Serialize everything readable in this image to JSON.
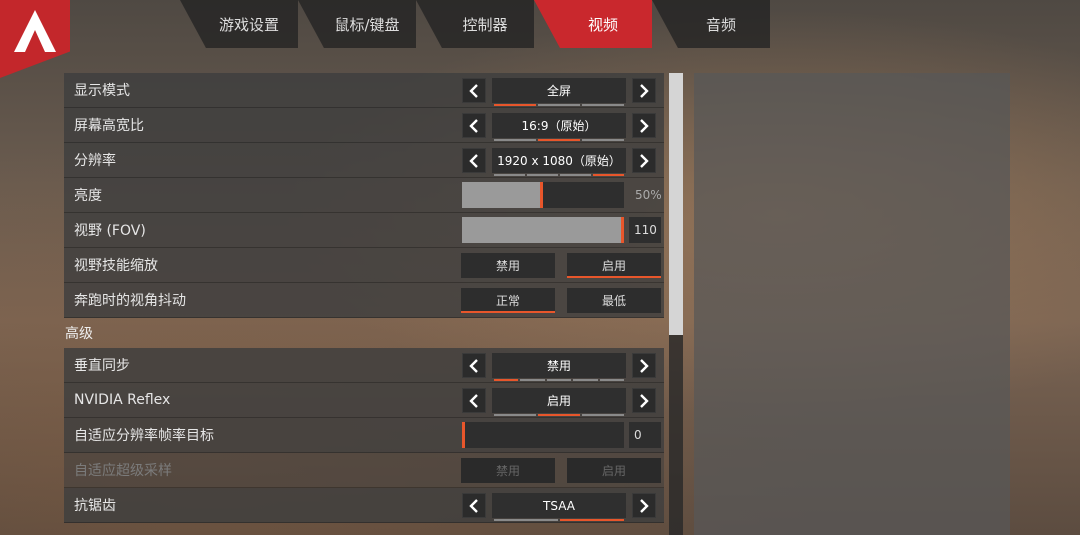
{
  "tabs": [
    {
      "label": "游戏设置",
      "active": false
    },
    {
      "label": "鼠标/键盘",
      "active": false
    },
    {
      "label": "控制器",
      "active": false
    },
    {
      "label": "视频",
      "active": true
    },
    {
      "label": "音频",
      "active": false
    }
  ],
  "settings": {
    "display_mode": {
      "label": "显示模式",
      "value": "全屏",
      "segments": 3,
      "selected_index": 0
    },
    "aspect_ratio": {
      "label": "屏幕高宽比",
      "value": "16:9（原始）",
      "segments": 3,
      "selected_index": 1
    },
    "resolution": {
      "label": "分辨率",
      "value": "1920 x 1080（原始）",
      "segments": 4,
      "selected_index": 3
    },
    "brightness": {
      "label": "亮度",
      "value": "50%",
      "level": 0.5
    },
    "fov": {
      "label": "视野 (FOV)",
      "value": "110",
      "level": 1.0
    },
    "fov_ability_scaling": {
      "label": "视野技能缩放",
      "options": [
        "禁用",
        "启用"
      ],
      "selected_index": 1
    },
    "sprint_view_shake": {
      "label": "奔跑时的视角抖动",
      "options": [
        "正常",
        "最低"
      ],
      "selected_index": 0
    }
  },
  "advanced": {
    "title": "高级",
    "vsync": {
      "label": "垂直同步",
      "value": "禁用",
      "segments": 5,
      "selected_index": 0
    },
    "nvidia_reflex": {
      "label": "NVIDIA Reflex",
      "value": "启用",
      "segments": 3,
      "selected_index": 1
    },
    "adaptive_res_target": {
      "label": "自适应分辨率帧率目标",
      "value": "0",
      "level": 0.0
    },
    "adaptive_supersampling": {
      "label": "自适应超级采样",
      "options": [
        "禁用",
        "启用"
      ],
      "selected_index": -1,
      "disabled": true
    },
    "anti_aliasing": {
      "label": "抗锯齿",
      "value": "TSAA",
      "segments": 2,
      "selected_index": 1
    }
  },
  "scrollbar": {
    "position": 0.0
  }
}
